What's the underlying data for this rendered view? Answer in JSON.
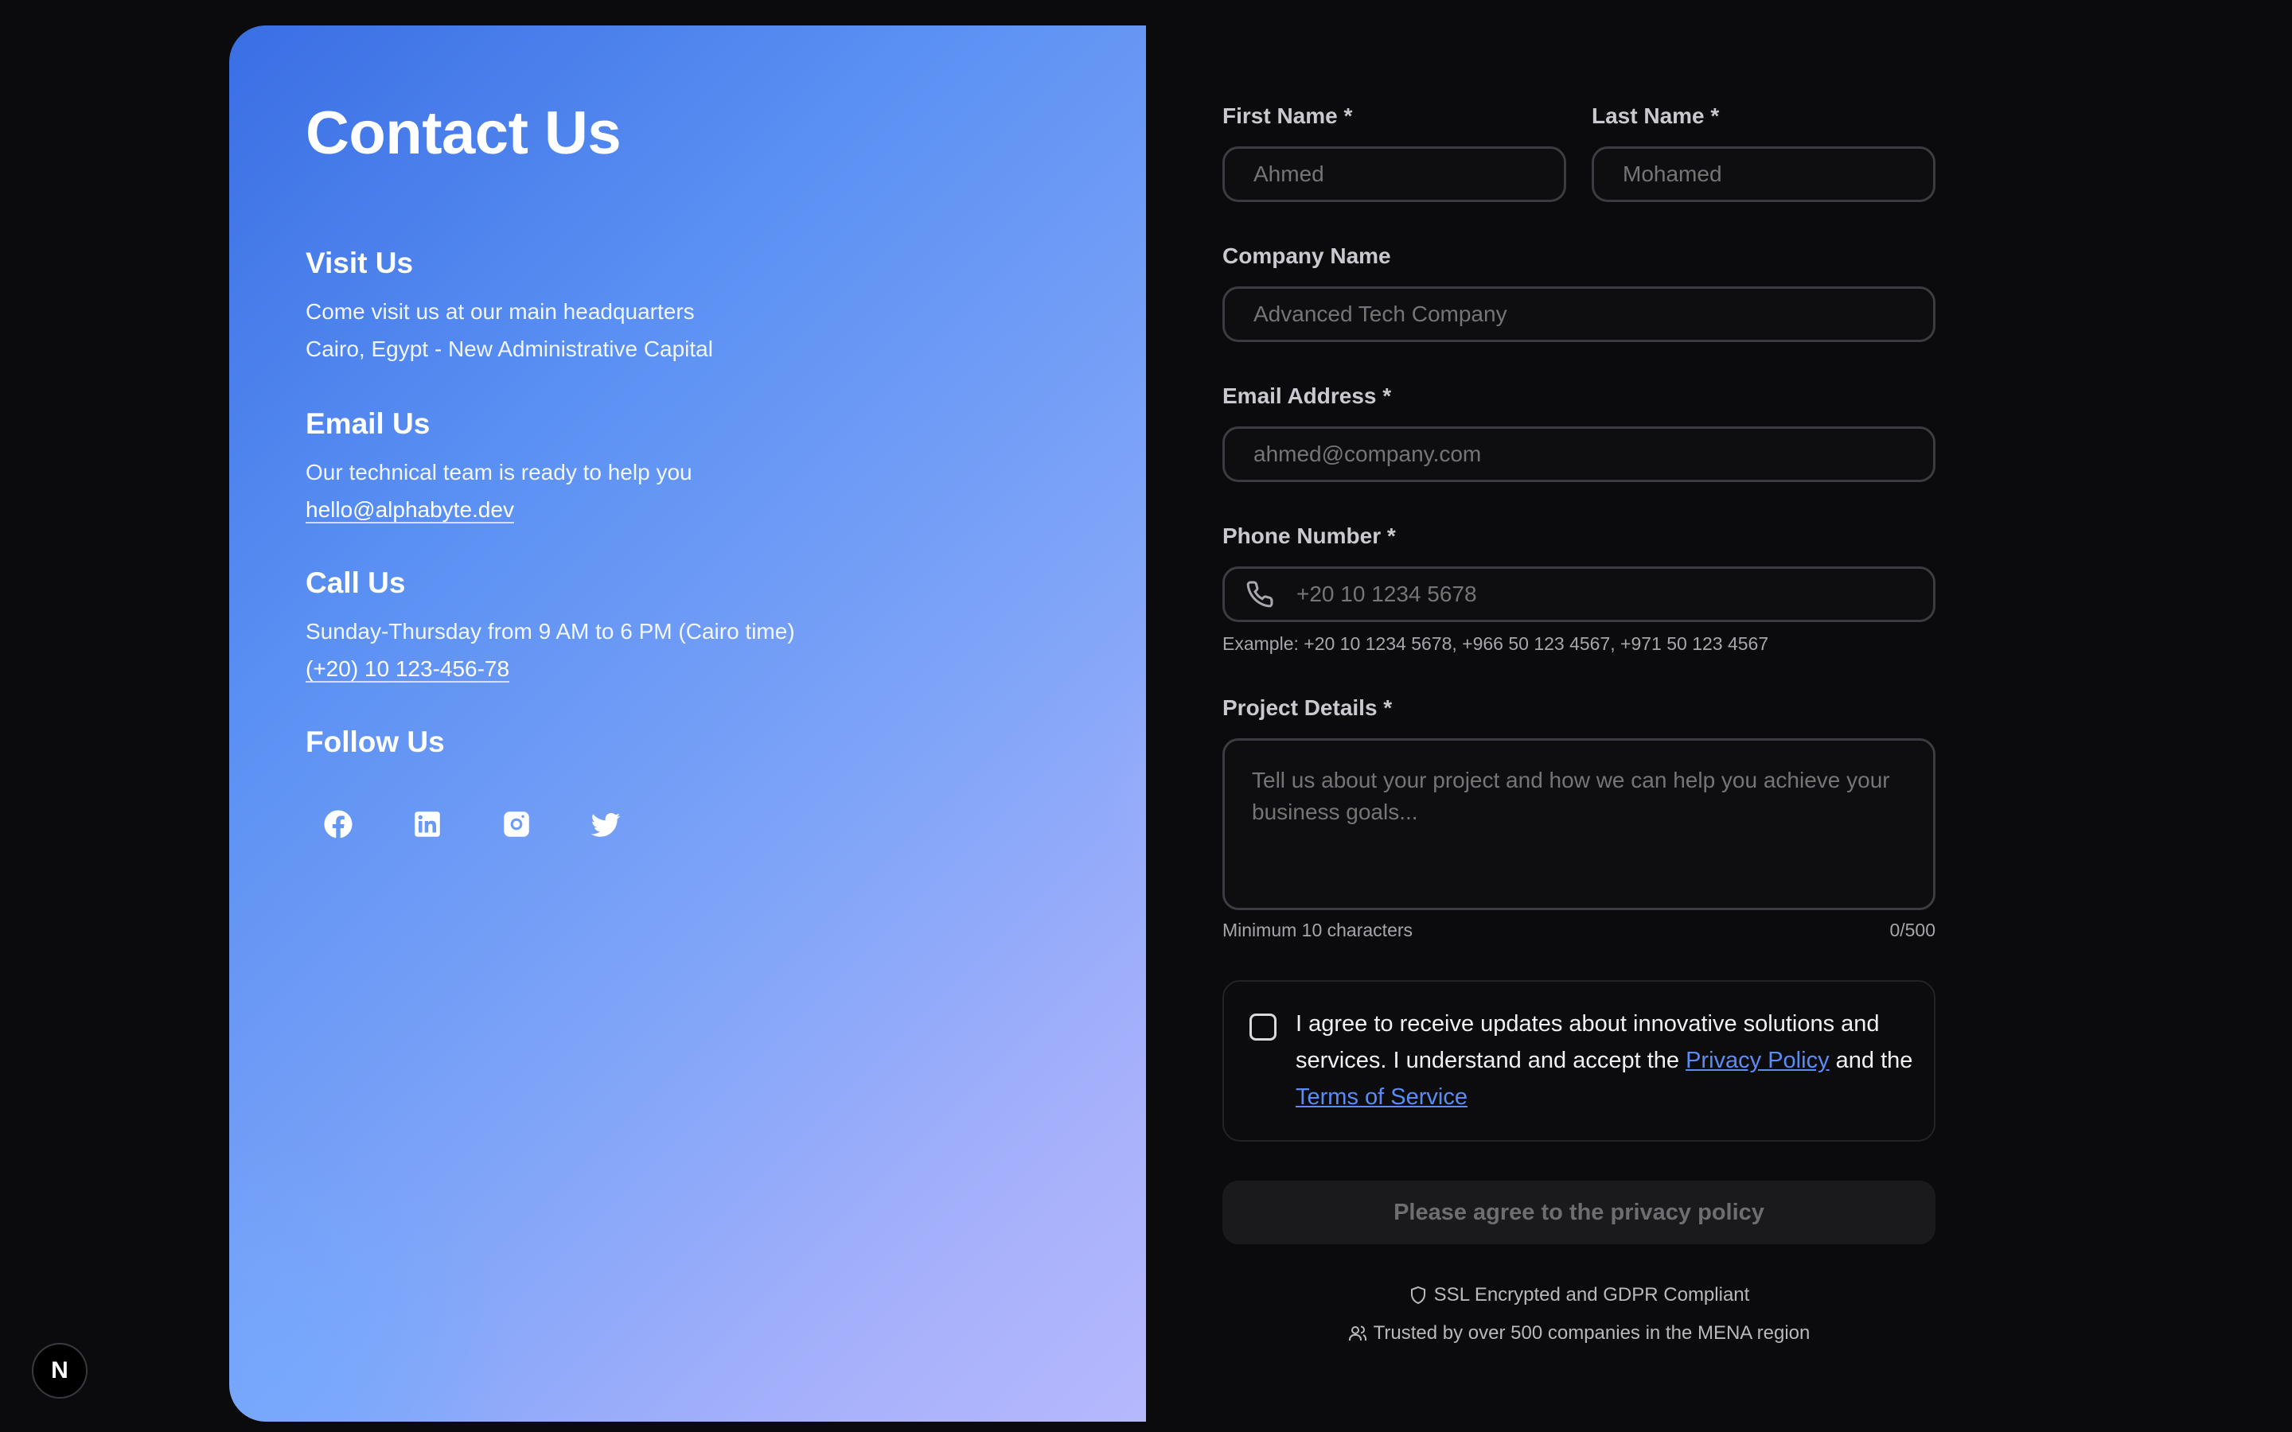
{
  "hero": {
    "title": "Contact Us",
    "visit": {
      "heading": "Visit Us",
      "line1": "Come visit us at our main headquarters",
      "line2": "Cairo, Egypt - New Administrative Capital"
    },
    "email": {
      "heading": "Email Us",
      "line1": "Our technical team is ready to help you",
      "link": "hello@alphabyte.dev"
    },
    "call": {
      "heading": "Call Us",
      "line1": "Sunday-Thursday from 9 AM to 6 PM (Cairo time)",
      "link": "(+20) 10 123-456-78"
    },
    "follow": {
      "heading": "Follow Us",
      "icons": [
        "facebook-icon",
        "linkedin-icon",
        "instagram-icon",
        "twitter-icon"
      ]
    }
  },
  "form": {
    "first_name": {
      "label": "First Name *",
      "placeholder": "Ahmed"
    },
    "last_name": {
      "label": "Last Name *",
      "placeholder": "Mohamed"
    },
    "company": {
      "label": "Company Name",
      "placeholder": "Advanced Tech Company"
    },
    "email": {
      "label": "Email Address *",
      "placeholder": "ahmed@company.com"
    },
    "phone": {
      "label": "Phone Number *",
      "placeholder": "+20 10 1234 5678",
      "hint": "Example: +20 10 1234 5678, +966 50 123 4567, +971 50 123 4567"
    },
    "project": {
      "label": "Project Details *",
      "placeholder": "Tell us about your project and how we can help you achieve your business goals...",
      "hint_min": "Minimum 10 characters",
      "counter": "0/500"
    },
    "consent": {
      "text_before": "I agree to receive updates about innovative solutions and services. I understand and accept the ",
      "privacy_link": "Privacy Policy",
      "text_mid": " and the ",
      "terms_link": "Terms of Service",
      "checked": false
    },
    "submit_label": "Please agree to the privacy policy",
    "trust": {
      "ssl": "SSL Encrypted and GDPR Compliant",
      "trusted": "Trusted by over 500 companies in the MENA region"
    }
  },
  "badge": {
    "letter": "N"
  },
  "colors": {
    "background": "#0b0b0d",
    "accent_link": "#5b8cf5",
    "hero_gradient_start": "#3a6ee4",
    "hero_gradient_end": "#b6b8fc"
  }
}
